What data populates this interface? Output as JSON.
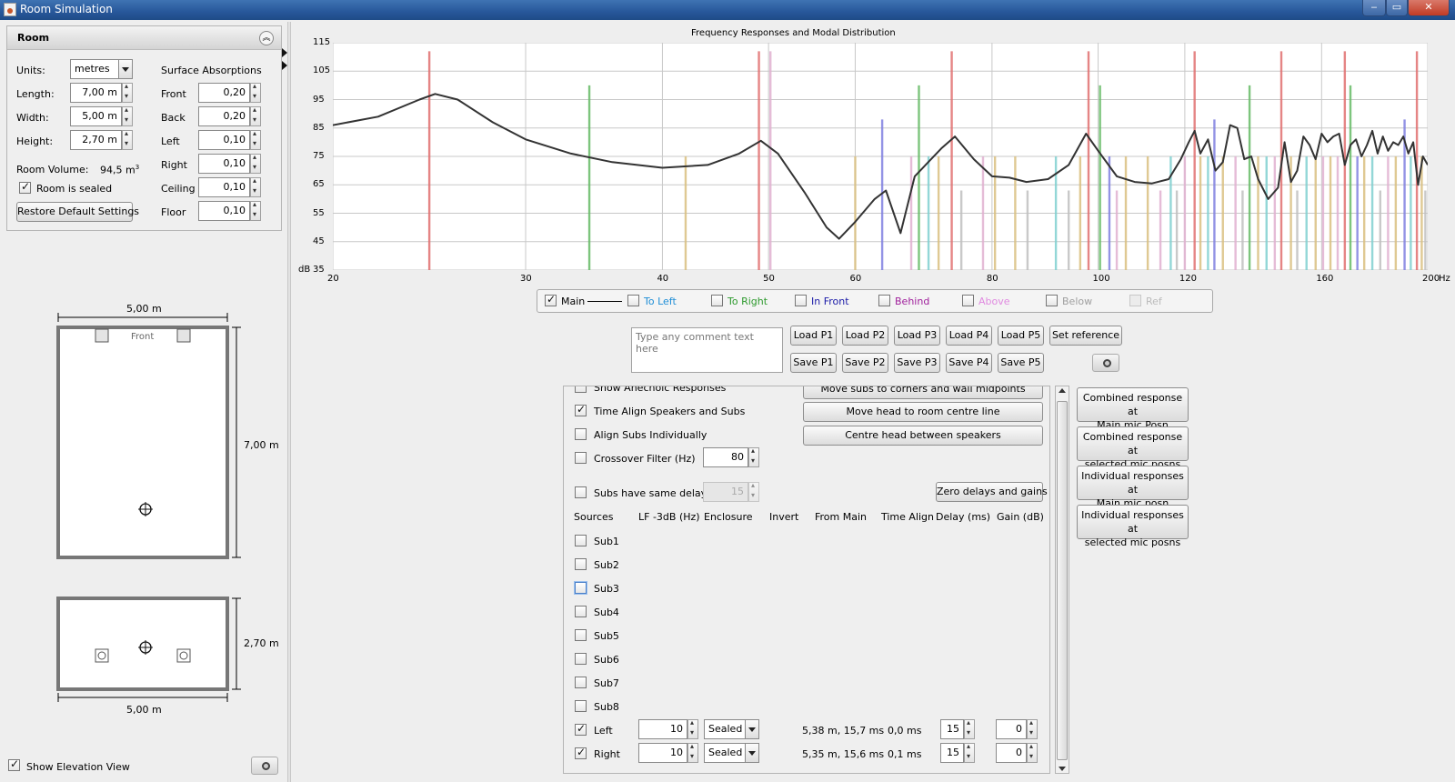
{
  "window": {
    "title": "Room Simulation"
  },
  "room_panel": {
    "header": "Room",
    "units_label": "Units:",
    "units_value": "metres",
    "length_label": "Length:",
    "length_value": "7,00 m",
    "width_label": "Width:",
    "width_value": "5,00 m",
    "height_label": "Height:",
    "height_value": "2,70 m",
    "volume_label": "Room Volume:",
    "volume_value": "94,5 m",
    "volume_sup": "3",
    "sealed_label": "Room is sealed",
    "restore_button": "Restore Default Settings",
    "absorptions_header": "Surface Absorptions",
    "absorptions": [
      {
        "label": "Front",
        "value": "0,20"
      },
      {
        "label": "Back",
        "value": "0,20"
      },
      {
        "label": "Left",
        "value": "0,10"
      },
      {
        "label": "Right",
        "value": "0,10"
      },
      {
        "label": "Ceiling",
        "value": "0,10"
      },
      {
        "label": "Floor",
        "value": "0,10"
      }
    ]
  },
  "plan_view": {
    "width_dim": "5,00 m",
    "length_dim": "7,00 m",
    "front_label": "Front"
  },
  "elevation_view": {
    "height_dim": "2,70 m",
    "width_dim": "5,00 m"
  },
  "show_elevation_label": "Show Elevation View",
  "chart_data": {
    "type": "line",
    "title": "Frequency Responses and Modal Distribution",
    "xlabel": "Hz",
    "ylabel": "dB",
    "x_scale": "log",
    "xlim": [
      20,
      200
    ],
    "ylim": [
      35,
      115
    ],
    "x_ticks": [
      20,
      30,
      40,
      50,
      60,
      80,
      100,
      120,
      160,
      200
    ],
    "y_ticks": [
      35,
      45,
      55,
      65,
      75,
      85,
      95,
      105,
      115
    ],
    "series": [
      {
        "name": "Main",
        "x": [
          20,
          22,
          24,
          24.8,
          26,
          28,
          30,
          33,
          36,
          40,
          44,
          47,
          49.2,
          51,
          54,
          56.5,
          58,
          60,
          62.5,
          64,
          66,
          68,
          72,
          74,
          77,
          80,
          83,
          86,
          90,
          94,
          97.5,
          100,
          104,
          108,
          112,
          116,
          119,
          121,
          122.5,
          124,
          126,
          128,
          130,
          132,
          134,
          136,
          138,
          140,
          143,
          146,
          148,
          150,
          152,
          154,
          156,
          158,
          160,
          162,
          164,
          166,
          168,
          170,
          172,
          174,
          176,
          178,
          180,
          182,
          184,
          186,
          188,
          190,
          192,
          194,
          196,
          198,
          200
        ],
        "y": [
          86,
          89,
          95,
          97,
          95,
          87,
          81,
          76,
          73,
          71,
          72,
          76,
          80.5,
          76,
          62,
          50,
          46,
          52,
          60,
          63,
          48,
          68,
          78,
          82,
          74,
          68,
          67.5,
          66,
          67,
          72,
          83,
          77,
          68,
          66,
          65.5,
          67,
          74,
          80,
          84,
          76,
          81,
          70,
          73,
          86,
          85,
          74,
          75,
          67,
          60,
          64,
          80,
          66,
          70,
          82,
          79,
          74,
          83,
          80,
          82,
          83,
          72,
          79,
          81,
          75,
          79,
          84,
          76,
          82,
          77,
          80,
          79,
          82,
          76,
          80,
          65,
          75,
          72
        ]
      }
    ],
    "modes": [
      {
        "f": 24.5,
        "h": 112,
        "color": "#e07070"
      },
      {
        "f": 34.3,
        "h": 100,
        "color": "#66bb66"
      },
      {
        "f": 42,
        "h": 75,
        "color": "#d9c080"
      },
      {
        "f": 49,
        "h": 112,
        "color": "#e07070"
      },
      {
        "f": 50.2,
        "h": 112,
        "color": "#e0b0d0"
      },
      {
        "f": 60,
        "h": 75,
        "color": "#d9c080"
      },
      {
        "f": 63.5,
        "h": 88,
        "color": "#8080e0"
      },
      {
        "f": 68.6,
        "h": 100,
        "color": "#66bb66"
      },
      {
        "f": 67.5,
        "h": 75,
        "color": "#e0b0d0"
      },
      {
        "f": 70,
        "h": 75,
        "color": "#80d0d0"
      },
      {
        "f": 71.5,
        "h": 75,
        "color": "#d9c080"
      },
      {
        "f": 73.5,
        "h": 112,
        "color": "#e07070"
      },
      {
        "f": 75,
        "h": 63,
        "color": "#c0c0c0"
      },
      {
        "f": 78.5,
        "h": 75,
        "color": "#e0b0d0"
      },
      {
        "f": 80.5,
        "h": 75,
        "color": "#d9c080"
      },
      {
        "f": 84,
        "h": 75,
        "color": "#d9c080"
      },
      {
        "f": 86.2,
        "h": 63,
        "color": "#c0c0c0"
      },
      {
        "f": 91.5,
        "h": 75,
        "color": "#80d0d0"
      },
      {
        "f": 94,
        "h": 63,
        "color": "#c0c0c0"
      },
      {
        "f": 96.3,
        "h": 75,
        "color": "#d9c080"
      },
      {
        "f": 98,
        "h": 112,
        "color": "#e07070"
      },
      {
        "f": 100.4,
        "h": 100,
        "color": "#66bb66"
      },
      {
        "f": 102.4,
        "h": 75,
        "color": "#8080e0"
      },
      {
        "f": 104,
        "h": 63,
        "color": "#e0b0d0"
      },
      {
        "f": 106,
        "h": 75,
        "color": "#d9c080"
      },
      {
        "f": 111,
        "h": 75,
        "color": "#d9c080"
      },
      {
        "f": 114,
        "h": 63,
        "color": "#e0b0d0"
      },
      {
        "f": 116.5,
        "h": 75,
        "color": "#80d0d0"
      },
      {
        "f": 118,
        "h": 63,
        "color": "#c0c0c0"
      },
      {
        "f": 120,
        "h": 75,
        "color": "#e0b0d0"
      },
      {
        "f": 122.5,
        "h": 112,
        "color": "#e07070"
      },
      {
        "f": 124,
        "h": 75,
        "color": "#d9c080"
      },
      {
        "f": 126,
        "h": 75,
        "color": "#80d0d0"
      },
      {
        "f": 127.7,
        "h": 88,
        "color": "#8080e0"
      },
      {
        "f": 130,
        "h": 75,
        "color": "#d9c080"
      },
      {
        "f": 133.5,
        "h": 75,
        "color": "#e0b0d0"
      },
      {
        "f": 135.5,
        "h": 63,
        "color": "#c0c0c0"
      },
      {
        "f": 137.5,
        "h": 100,
        "color": "#66bb66"
      },
      {
        "f": 140,
        "h": 75,
        "color": "#d9c080"
      },
      {
        "f": 142.5,
        "h": 75,
        "color": "#80d0d0"
      },
      {
        "f": 145,
        "h": 75,
        "color": "#e0b0d0"
      },
      {
        "f": 147,
        "h": 112,
        "color": "#e07070"
      },
      {
        "f": 150,
        "h": 75,
        "color": "#d9c080"
      },
      {
        "f": 152,
        "h": 63,
        "color": "#c0c0c0"
      },
      {
        "f": 155,
        "h": 75,
        "color": "#80d0d0"
      },
      {
        "f": 158,
        "h": 75,
        "color": "#d9c080"
      },
      {
        "f": 160.5,
        "h": 75,
        "color": "#e0b0d0"
      },
      {
        "f": 163,
        "h": 75,
        "color": "#d9c080"
      },
      {
        "f": 165.5,
        "h": 75,
        "color": "#e0b0d0"
      },
      {
        "f": 168,
        "h": 112,
        "color": "#e07070"
      },
      {
        "f": 170,
        "h": 100,
        "color": "#66bb66"
      },
      {
        "f": 172.5,
        "h": 75,
        "color": "#8080e0"
      },
      {
        "f": 175,
        "h": 75,
        "color": "#d9c080"
      },
      {
        "f": 178,
        "h": 75,
        "color": "#80d0d0"
      },
      {
        "f": 181,
        "h": 63,
        "color": "#c0c0c0"
      },
      {
        "f": 184,
        "h": 75,
        "color": "#e0b0d0"
      },
      {
        "f": 187,
        "h": 75,
        "color": "#d9c080"
      },
      {
        "f": 190.5,
        "h": 88,
        "color": "#8080e0"
      },
      {
        "f": 193,
        "h": 75,
        "color": "#80d0d0"
      },
      {
        "f": 195.5,
        "h": 112,
        "color": "#e07070"
      },
      {
        "f": 197.5,
        "h": 75,
        "color": "#d9c080"
      },
      {
        "f": 199,
        "h": 63,
        "color": "#c0c0c0"
      }
    ],
    "grid": true
  },
  "legend": [
    {
      "label": "Main",
      "checked": true,
      "color": "#000000"
    },
    {
      "label": "To Left",
      "checked": false,
      "color": "#1f8ed6"
    },
    {
      "label": "To Right",
      "checked": false,
      "color": "#2e9a2e"
    },
    {
      "label": "In Front",
      "checked": false,
      "color": "#1a1aa8"
    },
    {
      "label": "Behind",
      "checked": false,
      "color": "#a0209c"
    },
    {
      "label": "Above",
      "checked": false,
      "color": "#e08ae0"
    },
    {
      "label": "Below",
      "checked": false,
      "color": "#a0a0a0"
    },
    {
      "label": "Ref",
      "checked": false,
      "color": "#bbbbbb"
    }
  ],
  "comment_placeholder": "Type any comment text here",
  "load_buttons": [
    "Load P1",
    "Load P2",
    "Load P3",
    "Load P4",
    "Load P5"
  ],
  "save_buttons": [
    "Save P1",
    "Save P2",
    "Save P3",
    "Save P4",
    "Save P5"
  ],
  "set_reference": "Set reference",
  "options": {
    "anechoic": "Show Anechoic Responses",
    "time_align": "Time Align Speakers and Subs",
    "align_subs": "Align Subs Individually",
    "crossover": "Crossover Filter (Hz)",
    "crossover_value": "80",
    "same_delay": "Subs have same delay",
    "same_delay_value": "15",
    "move_subs": "Move subs to corners and wall midpoints",
    "move_head": "Move head to room centre line",
    "centre_head": "Centre head between speakers",
    "zero_delays": "Zero delays and gains"
  },
  "sources_table": {
    "headers": [
      "Sources",
      "LF -3dB (Hz)",
      "Enclosure",
      "Invert",
      "From Main",
      "Time Align",
      "Delay (ms)",
      "Gain (dB)"
    ],
    "subs": [
      "Sub1",
      "Sub2",
      "Sub3",
      "Sub4",
      "Sub5",
      "Sub6",
      "Sub7",
      "Sub8"
    ],
    "speakers": [
      {
        "name": "Left",
        "checked": true,
        "lf": "10",
        "enclosure": "Sealed",
        "from_main": "5,38 m, 15,7 ms",
        "time_align": "0,0 ms",
        "delay": "15",
        "gain": "0"
      },
      {
        "name": "Right",
        "checked": true,
        "lf": "10",
        "enclosure": "Sealed",
        "from_main": "5,35 m, 15,6 ms",
        "time_align": "0,1 ms",
        "delay": "15",
        "gain": "0"
      }
    ]
  },
  "response_buttons": [
    [
      "Combined response at",
      "Main mic Posn"
    ],
    [
      "Combined response at",
      "selected mic posns"
    ],
    [
      "Individual responses at",
      "Main mic posn"
    ],
    [
      "Individual responses at",
      "selected mic posns"
    ]
  ]
}
